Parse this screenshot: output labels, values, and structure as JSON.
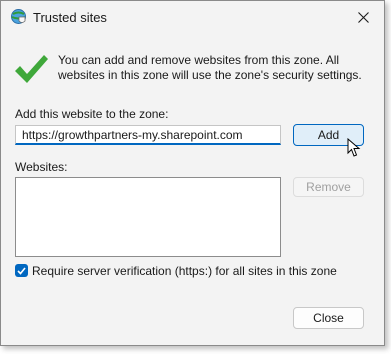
{
  "window": {
    "title": "Trusted sites"
  },
  "intro_text": "You can add and remove websites from this zone. All websites in this zone will use the zone's security settings.",
  "add_section": {
    "label": "Add this website to the zone:",
    "input_value": "https://growthpartners-my.sharepoint.com",
    "add_button": "Add"
  },
  "websites_section": {
    "label": "Websites:",
    "items": [],
    "remove_button": "Remove"
  },
  "verification": {
    "label": "Require server verification (https:) for all sites in this zone",
    "checked": true
  },
  "footer": {
    "close_button": "Close"
  },
  "icons": {
    "title": "globe-shield-icon",
    "close": "close-icon",
    "check": "checkmark-icon",
    "cursor": "mouse-pointer-icon"
  },
  "colors": {
    "accent": "#0067c0",
    "check_green": "#3fa83a",
    "window_bg": "#f3f3f3"
  }
}
